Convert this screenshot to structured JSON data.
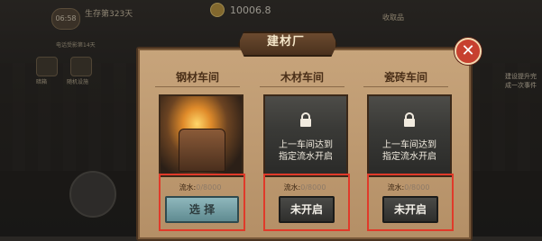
{
  "hud": {
    "timer": "06:58",
    "survive_days": "生存第323天",
    "money": "10006.8",
    "receive_label": "收取品",
    "icon1_label": "暗箱",
    "icon2_label": "随机设施",
    "record_label": "电话受影第14天",
    "right_text": "建设提升完成一次事件"
  },
  "modal": {
    "title": "建材厂",
    "workshops": [
      {
        "name": "钢材车间",
        "state": "unlocked",
        "flow_label": "流水:",
        "flow_value": "0/8000",
        "button": "选 择"
      },
      {
        "name": "木材车间",
        "state": "locked",
        "lock_text_1": "上一车间达到",
        "lock_text_2": "指定流水开启",
        "flow_label": "流水:",
        "flow_value": "0/8000",
        "button": "未开启"
      },
      {
        "name": "瓷砖车间",
        "state": "locked",
        "lock_text_1": "上一车间达到",
        "lock_text_2": "指定流水开启",
        "flow_label": "流水:",
        "flow_value": "0/8000",
        "button": "未开启"
      }
    ]
  },
  "colors": {
    "highlight": "#e03a2a",
    "select_button": "#7aa5ab",
    "closed_button": "#3a3a38",
    "panel": "#c2a073"
  }
}
